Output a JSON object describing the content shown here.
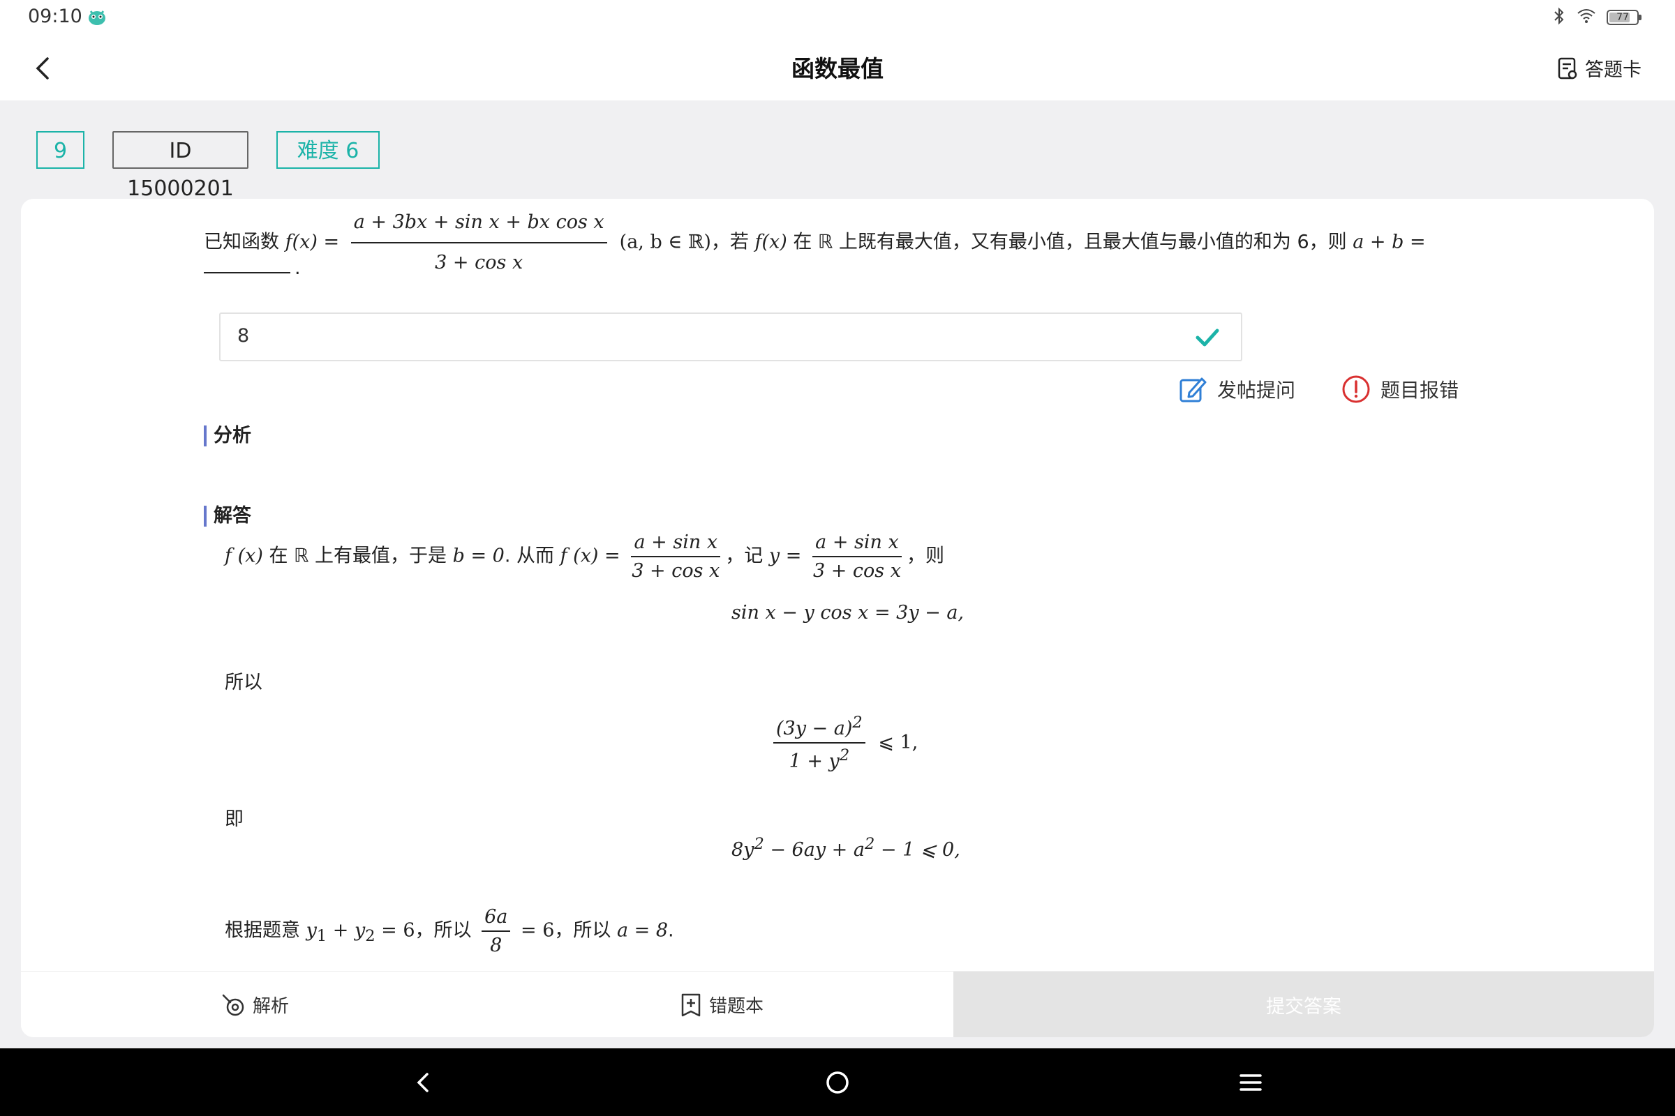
{
  "status_bar": {
    "time": "09:10",
    "battery_level": "77"
  },
  "header": {
    "title": "函数最值",
    "answer_card_label": "答题卡"
  },
  "tags": {
    "number": "9",
    "id": "ID 15000201",
    "difficulty": "难度 6"
  },
  "question": {
    "prefix": "已知函数 ",
    "f_x": "f(x) =",
    "frac_num": "a + 3bx + sin x + bx cos x",
    "frac_den": "3 + cos x",
    "domain": "(a, b ∈ ℝ)",
    "middle": "，若 ",
    "f_x2": "f(x)",
    "text1": " 在 ℝ 上既有最大值，又有最小值，且最大值与最小值的和为 6，则 ",
    "ask": "a + b =",
    "end_dot": "."
  },
  "answer": {
    "value": "8",
    "status": "correct"
  },
  "actions": {
    "post_question": "发帖提问",
    "report_error": "题目报错"
  },
  "sections": {
    "analysis": "分析",
    "solution": "解答"
  },
  "solution": {
    "line1_a": "f (x)",
    "line1_b": " 在 ℝ 上有最值，于是 ",
    "line1_c": "b = 0",
    "line1_d": ".  从而 ",
    "line1_e": "f (x) =",
    "line1_frac_num": "a + sin x",
    "line1_frac_den": "3 + cos x",
    "line1_f": "，记 ",
    "line1_g": "y =",
    "line1_frac2_num": "a + sin x",
    "line1_frac2_den": "3 + cos x",
    "line1_h": "，则",
    "eq1": "sin x − y cos x = 3y − a,",
    "text_so": "所以",
    "eq2_num": "(3y − a)",
    "eq2_num_sup": "2",
    "eq2_den": "1 + y",
    "eq2_den_sup": "2",
    "eq2_tail": "⩽ 1,",
    "text_ie": "即",
    "eq3_a": "8y",
    "eq3_sup1": "2",
    "eq3_b": " − 6ay + a",
    "eq3_sup2": "2",
    "eq3_c": " − 1 ⩽ 0,",
    "final_a": "根据题意 ",
    "final_b": "y",
    "final_sub1": "1",
    "final_c": " + y",
    "final_sub2": "2",
    "final_d": " = 6",
    "final_e": "，所以 ",
    "final_frac_num": "6a",
    "final_frac_den": "8",
    "final_f": " = 6",
    "final_g": "，所以 ",
    "final_h": "a = 8",
    "final_i": "."
  },
  "toolbar": {
    "explain": "解析",
    "wrong_book": "错题本",
    "submit": "提交答案"
  },
  "colors": {
    "accent": "#1bb3a8",
    "section_bar": "#6677cc",
    "error_red": "#d93030",
    "edit_blue": "#2f7fd6"
  }
}
